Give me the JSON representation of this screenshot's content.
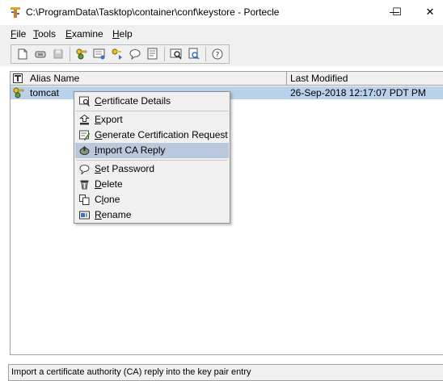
{
  "window": {
    "title": "C:\\ProgramData\\Tasktop\\container\\conf\\keystore - Portecle",
    "min_glyph": "—",
    "max_glyph": "☐",
    "close_glyph": "✕"
  },
  "menubar": [
    {
      "mnemonic": "F",
      "rest": "ile"
    },
    {
      "mnemonic": "T",
      "rest": "ools"
    },
    {
      "mnemonic": "E",
      "rest": "xamine"
    },
    {
      "mnemonic": "H",
      "rest": "elp"
    }
  ],
  "toolbar": {
    "icons": [
      "new-keystore-icon",
      "open-keystore-icon",
      "save-keystore-icon",
      "generate-keypair-icon",
      "import-trusted-cert-icon",
      "import-keypair-icon",
      "set-password-icon",
      "keystore-report-icon",
      "examine-certificate-icon",
      "examine-ssl-icon",
      "help-icon"
    ]
  },
  "table": {
    "columns": [
      "Alias Name",
      "Last Modified"
    ],
    "rows": [
      {
        "alias": "tomcat",
        "last_modified": "26-Sep-2018 12:17:07 PDT PM",
        "icon": "keypair-entry-icon"
      }
    ]
  },
  "context_menu": {
    "items": [
      {
        "pre": "",
        "mnemonic": "C",
        "post": "ertificate Details",
        "icon": "certificate-details-icon"
      },
      {
        "pre": "",
        "mnemonic": "E",
        "post": "xport",
        "icon": "export-icon"
      },
      {
        "pre": "",
        "mnemonic": "G",
        "post": "enerate Certification Request",
        "icon": "generate-csr-icon"
      },
      {
        "pre": "",
        "mnemonic": "I",
        "post": "mport CA Reply",
        "icon": "import-ca-reply-icon",
        "highlighted": true
      },
      {
        "pre": "",
        "mnemonic": "S",
        "post": "et Password",
        "icon": "set-password-icon"
      },
      {
        "pre": "",
        "mnemonic": "D",
        "post": "elete",
        "icon": "delete-icon"
      },
      {
        "pre": "C",
        "mnemonic": "l",
        "post": "one",
        "icon": "clone-icon"
      },
      {
        "pre": "",
        "mnemonic": "R",
        "post": "ename",
        "icon": "rename-icon"
      }
    ]
  },
  "statusbar": {
    "text": "Import a certificate authority (CA) reply into the key pair entry"
  },
  "colors": {
    "selection": "#b9d1ea",
    "menu_highlight": "#b8c9dd",
    "chrome": "#f0f0f0"
  }
}
